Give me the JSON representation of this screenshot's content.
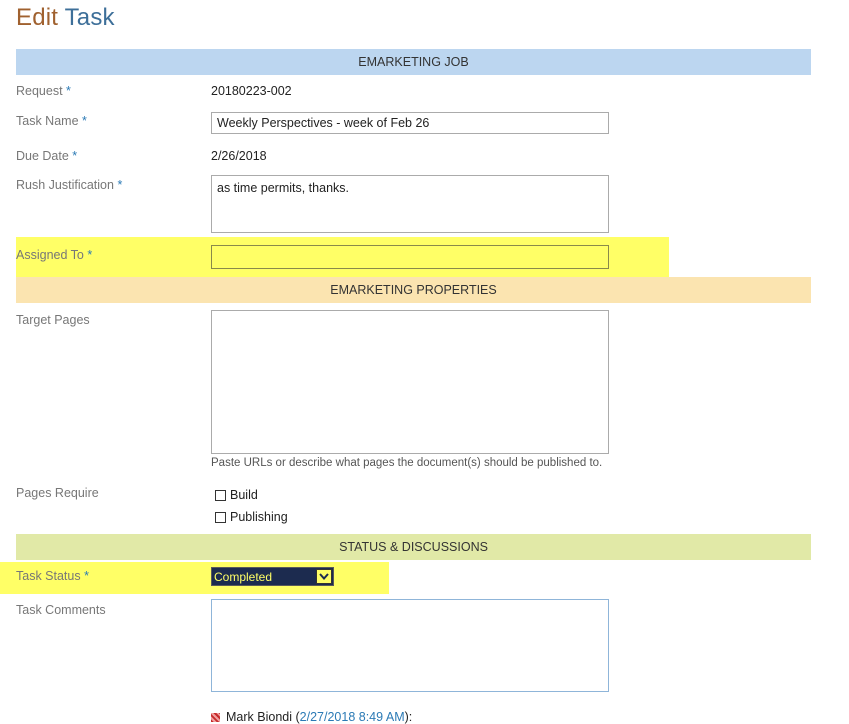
{
  "page": {
    "title_word1": "Edit",
    "title_word2": "Task"
  },
  "colors": {
    "highlight": "#ffff66",
    "band_job": "#bcd6f0",
    "band_properties": "#fbe4b0",
    "band_status": "#e1e9a7",
    "title_edit": "#a0612f",
    "title_task": "#3d6f99",
    "required_star": "#2b7ab5"
  },
  "sections": {
    "job": "EMARKETING JOB",
    "properties": "EMARKETING PROPERTIES",
    "status": "STATUS & DISCUSSIONS"
  },
  "required_marker": "*",
  "fields": {
    "request": {
      "label": "Request",
      "value": "20180223-002"
    },
    "task_name": {
      "label": "Task Name",
      "value": "Weekly Perspectives - week of Feb 26"
    },
    "due_date": {
      "label": "Due Date",
      "value": "2/26/2018"
    },
    "rush_justification": {
      "label": "Rush Justification",
      "value": "as time permits, thanks."
    },
    "assigned_to": {
      "label": "Assigned To",
      "value": ""
    },
    "target_pages": {
      "label": "Target Pages",
      "value": "",
      "hint": "Paste URLs or describe what pages the document(s) should be published to."
    },
    "pages_require": {
      "label": "Pages Require",
      "options": [
        "Build",
        "Publishing"
      ]
    },
    "task_status": {
      "label": "Task Status",
      "value": "Completed"
    },
    "task_comments": {
      "label": "Task Comments",
      "value": ""
    }
  },
  "history": {
    "author": "Mark Biondi",
    "open_paren": "(",
    "timestamp": "2/27/2018 8:49 AM",
    "close": "):"
  },
  "icons": {
    "dropdown": "chevron-down-icon",
    "history_flag": "flag-icon"
  }
}
